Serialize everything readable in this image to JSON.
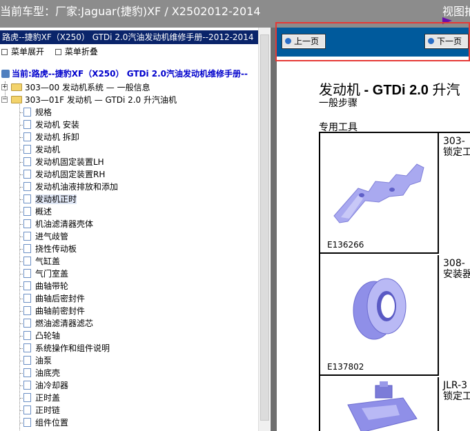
{
  "header": {
    "title": "当前车型：厂家:Jaguar(捷豹)XF / X2502012-2014",
    "view_label": "视图拍"
  },
  "left_pane": {
    "manual_title": "路虎--捷豹XF（X250） GTDi 2.0汽油发动机维修手册--2012-2014",
    "expand_label": "菜单展开",
    "collapse_label": "菜单折叠",
    "current_label": "当前:路虎--捷豹XF（X250） GTDi 2.0汽油发动机维修手册--",
    "tree": {
      "folder_1": "303—00 发动机系统 — 一般信息",
      "folder_2": "303—01F 发动机 — GTDi 2.0 升汽油机",
      "items": [
        "规格",
        "发动机 安装",
        "发动机 拆卸",
        "发动机",
        "发动机固定装置LH",
        "发动机固定装置RH",
        "发动机油液排放和添加",
        "发动机正时",
        "概述",
        "机油滤清器壳体",
        "进气歧管",
        "挠性传动板",
        "气缸盖",
        "气门室盖",
        "曲轴带轮",
        "曲轴后密封件",
        "曲轴前密封件",
        "燃油滤清器滤芯",
        "凸轮轴",
        "系统操作和组件说明",
        "油泵",
        "油底壳",
        "油冷却器",
        "正时盖",
        "正时链",
        "组件位置"
      ],
      "selected_index": 7
    }
  },
  "content": {
    "prev_label": "上一页",
    "next_label": "下一页",
    "title_prefix": "发动机",
    "title_bold": " - GTDi 2.0",
    "title_suffix": " 升汽",
    "subtitle": "一般步骤",
    "tools_heading": "专用工具",
    "tools": [
      {
        "image_code": "E136266",
        "code": "303-",
        "desc": "锁定工"
      },
      {
        "image_code": "E137802",
        "code": "308-",
        "desc": "安装器"
      },
      {
        "image_code": "",
        "code": "JLR-3",
        "desc": "锁定工"
      }
    ]
  },
  "colors": {
    "header_bg": "#8c8c8c",
    "title_bar_bg": "#0a246a",
    "nav_bar_bg": "#005a9c",
    "highlight_box": "#e53935",
    "tool_illustration": "#8f8fe8"
  }
}
